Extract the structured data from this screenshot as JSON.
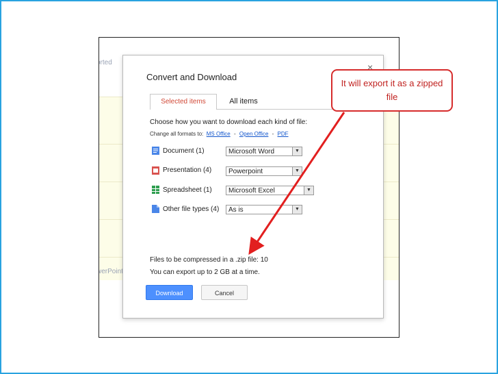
{
  "background_page": {
    "left_fragment_1": "orted",
    "left_fragment_2": "werPoint"
  },
  "dialog": {
    "title": "Convert and Download",
    "close_glyph": "×",
    "tabs": [
      {
        "label": "Selected items",
        "active": true
      },
      {
        "label": "All items",
        "active": false
      }
    ],
    "instruction": "Choose how you want to download each kind of file:",
    "change_all_label": "Change all formats to:",
    "format_links": [
      "MS Office",
      "Open Office",
      "PDF"
    ],
    "format_separator": "-",
    "file_types": [
      {
        "label": "Document",
        "count": "(1)",
        "selected": "Microsoft Word",
        "icon": "document-icon",
        "color": "#4a86e8"
      },
      {
        "label": "Presentation",
        "count": "(4)",
        "selected": "Powerpoint",
        "icon": "presentation-icon",
        "color": "#d9534f"
      },
      {
        "label": "Spreadsheet",
        "count": "(1)",
        "selected": "Microsoft Excel",
        "icon": "spreadsheet-icon",
        "color": "#2e9e4f"
      },
      {
        "label": "Other file types",
        "count": "(4)",
        "selected": "As is",
        "icon": "file-icon",
        "color": "#4a86e8"
      }
    ],
    "compress_info": "Files to be compressed in a .zip file: 10",
    "export_limit": "You can export up to 2 GB at a time.",
    "download_button": "Download",
    "cancel_button": "Cancel"
  },
  "callout": {
    "text": "It will export it as a zipped file",
    "color": "#d62b2b"
  },
  "accent": {
    "frame_border": "#29a3e0",
    "primary_button": "#4d90fe",
    "active_tab_text": "#d14836",
    "link": "#1155cc"
  }
}
